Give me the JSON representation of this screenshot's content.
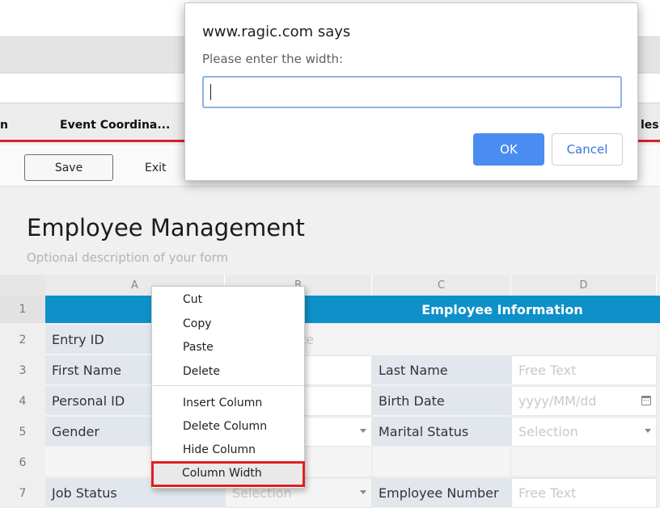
{
  "app": {
    "tabs": {
      "partial_left": "n",
      "event_coordinator": "Event Coordina...",
      "partial_right": "les"
    },
    "toolbar": {
      "save": "Save",
      "exit": "Exit"
    }
  },
  "form": {
    "title": "Employee Management",
    "description": "Optional description of your form"
  },
  "sheet": {
    "columns": [
      "A",
      "B",
      "C",
      "D"
    ],
    "rows": [
      "1",
      "2",
      "3",
      "4",
      "5",
      "6",
      "7"
    ],
    "section_header": "Employee Information",
    "cells": {
      "entry_id": "Entry ID",
      "entry_id_value": "ute",
      "first_name": "First Name",
      "last_name": "Last Name",
      "last_name_ph": "Free Text",
      "personal_id": "Personal ID",
      "birth_date": "Birth Date",
      "birth_date_ph": "yyyy/MM/dd",
      "gender": "Gender",
      "marital_status": "Marital Status",
      "marital_status_ph": "Selection",
      "job_status": "Job Status",
      "job_status_ph": "Selection",
      "employee_number": "Employee Number",
      "employee_number_ph": "Free Text"
    }
  },
  "context_menu": {
    "items": [
      "Cut",
      "Copy",
      "Paste",
      "Delete",
      "Insert Column",
      "Delete Column",
      "Hide Column",
      "Column Width"
    ],
    "highlighted": "Column Width"
  },
  "dialog": {
    "title": "www.ragic.com says",
    "message": "Please enter the width:",
    "input_value": "",
    "ok": "OK",
    "cancel": "Cancel"
  },
  "colors": {
    "accent_blue": "#0e90c9",
    "tab_red": "#d9202a",
    "highlight_red": "#e0201f",
    "ok_blue": "#4a8df0"
  }
}
